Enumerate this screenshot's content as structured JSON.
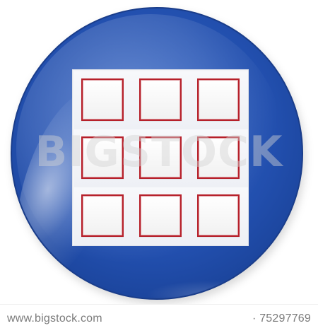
{
  "image": {
    "subject": "round-glossy-button-with-3x3-square-grid-icon",
    "colors": {
      "button_blue": "#224fae",
      "button_blue_dark": "#143988",
      "frame_red": "#b6202a",
      "card_white": "#f3f4f7",
      "footer_text": "#7b7b7b"
    }
  },
  "watermark": {
    "text": "BIGSTOCK"
  },
  "footer": {
    "left_text": "www.bigstock.com",
    "right_text": "· 75297769"
  }
}
